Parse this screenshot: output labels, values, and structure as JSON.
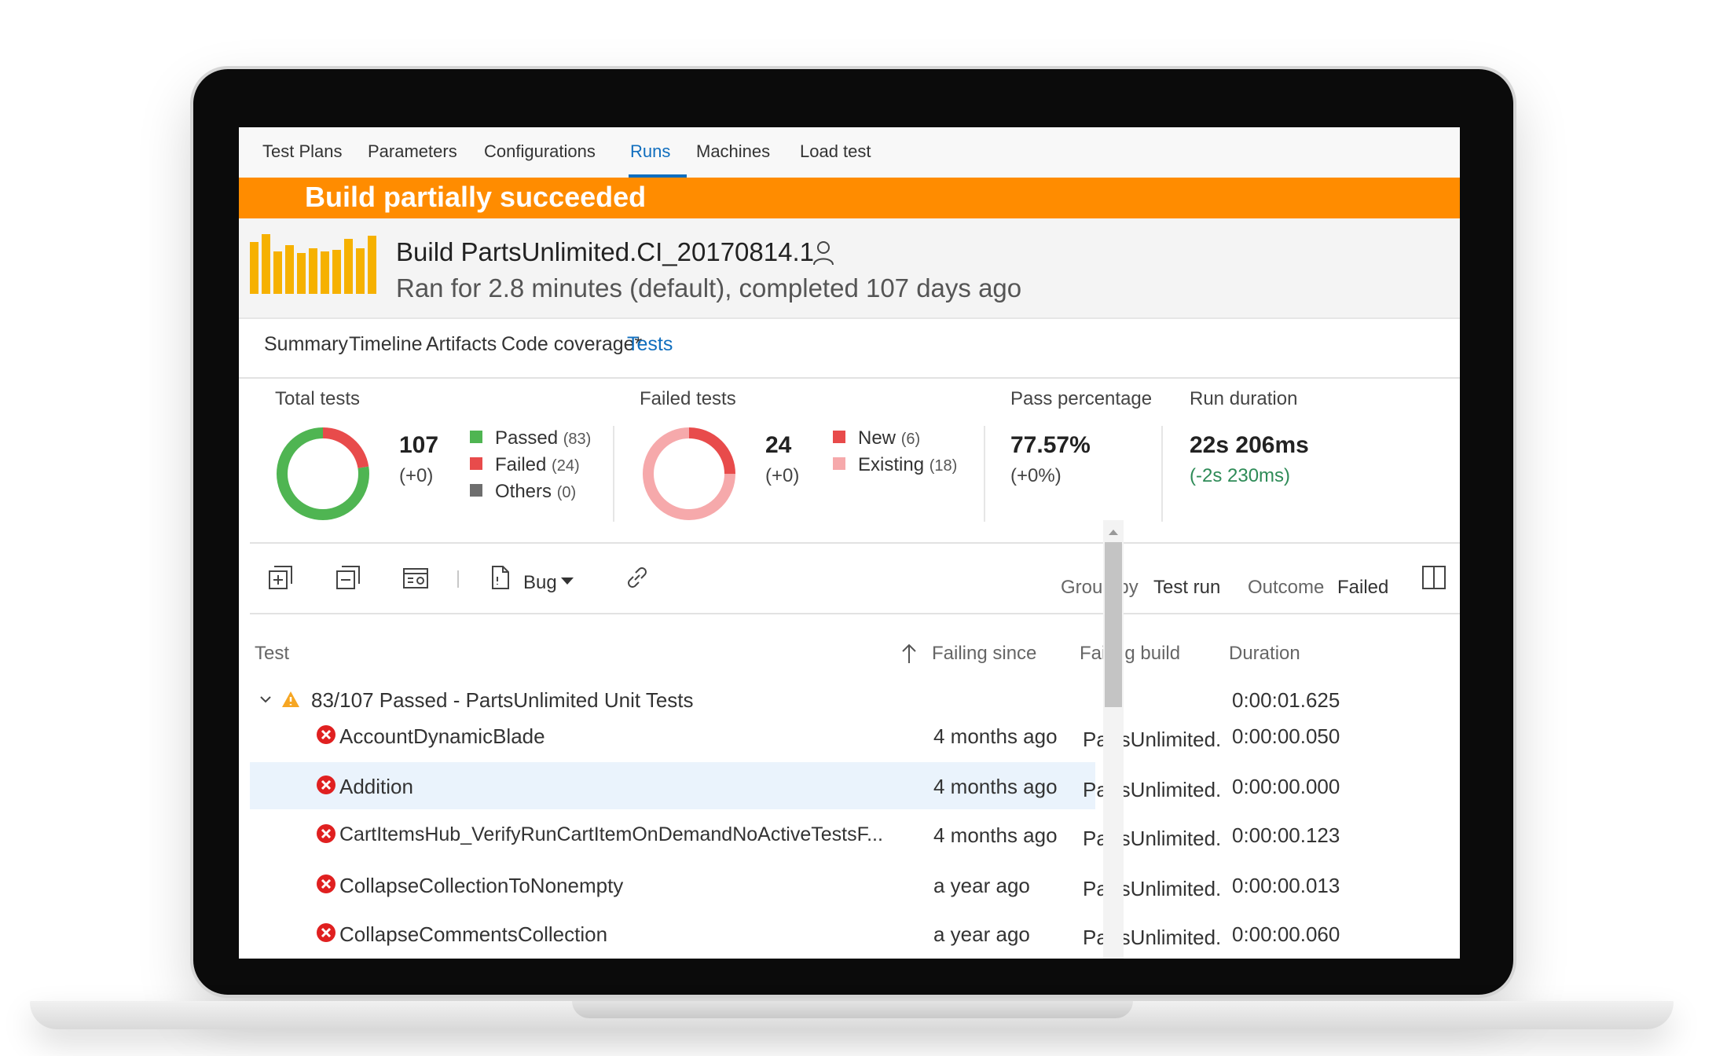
{
  "top_tabs": [
    "Test Plans",
    "Parameters",
    "Configurations",
    "Runs",
    "Machines",
    "Load test"
  ],
  "active_top_tab": "Runs",
  "banner": {
    "text": "Build partially succeeded",
    "color": "#ff8c00"
  },
  "build": {
    "title": "Build PartsUnlimited.CI_20170814.1",
    "subtitle": "Ran for 2.8 minutes (default), completed 107 days ago",
    "history_color": "#f6b100"
  },
  "sub_tabs": [
    "Summary",
    "Timeline",
    "Artifacts",
    "Code coverage*",
    "Tests"
  ],
  "active_sub_tab": "Tests",
  "summary": {
    "total": {
      "label": "Total tests",
      "value": "107",
      "delta": "(+0)",
      "legend": [
        {
          "label": "Passed",
          "count": "(83)",
          "color": "#4fb552"
        },
        {
          "label": "Failed",
          "count": "(24)",
          "color": "#e84b4b"
        },
        {
          "label": "Others",
          "count": "(0)",
          "color": "#6e6e6e"
        }
      ],
      "passed": 83,
      "failed": 24,
      "others": 0
    },
    "failed": {
      "label": "Failed tests",
      "value": "24",
      "delta": "(+0)",
      "legend": [
        {
          "label": "New",
          "count": "(6)",
          "color": "#e84b4b"
        },
        {
          "label": "Existing",
          "count": "(18)",
          "color": "#f6a9ab"
        }
      ],
      "new": 6,
      "existing": 18
    },
    "pass_percentage": {
      "label": "Pass percentage",
      "value": "77.57%",
      "delta": "(+0%)"
    },
    "run_duration": {
      "label": "Run duration",
      "value": "22s 206ms",
      "delta": "(-2s 230ms)",
      "delta_color": "#2e8b57"
    }
  },
  "toolbar": {
    "bug_label": "Bug",
    "group_by_label": "Group by",
    "group_by_value": "Test run",
    "outcome_label": "Outcome",
    "outcome_value": "Failed"
  },
  "columns": {
    "test": "Test",
    "failing_since": "Failing since",
    "failing_build": "Failing build",
    "duration": "Duration"
  },
  "group": {
    "label": "83/107 Passed - PartsUnlimited Unit Tests",
    "duration": "0:00:01.625"
  },
  "rows": [
    {
      "name": "AccountDynamicBlade",
      "since": "4 months ago",
      "build": "PartsUnlimited.",
      "duration": "0:00:00.050"
    },
    {
      "name": "Addition",
      "since": "4 months ago",
      "build": "PartsUnlimited.",
      "duration": "0:00:00.000"
    },
    {
      "name": "CartItemsHub_VerifyRunCartItemOnDemandNoActiveTestsF...",
      "since": "4 months ago",
      "build": "PartsUnlimited.",
      "duration": "0:00:00.123"
    },
    {
      "name": "CollapseCollectionToNonempty",
      "since": "a year ago",
      "build": "PartsUnlimited.",
      "duration": "0:00:00.013"
    },
    {
      "name": "CollapseCommentsCollection",
      "since": "a year ago",
      "build": "PartsUnlimited.",
      "duration": "0:00:00.060"
    }
  ]
}
